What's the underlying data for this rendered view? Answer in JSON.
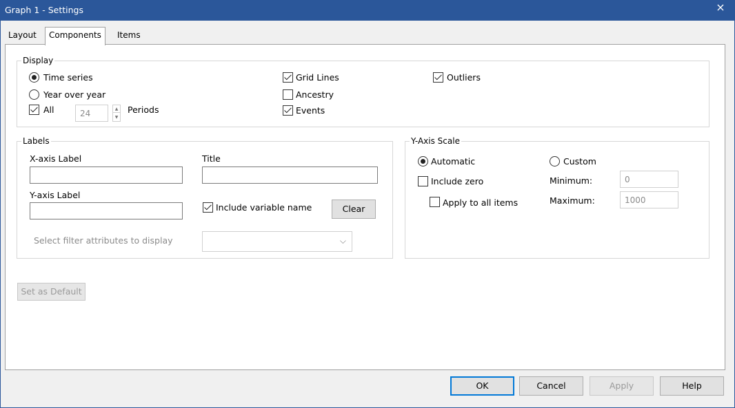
{
  "window": {
    "title": "Graph 1 - Settings",
    "close_glyph": "×"
  },
  "tabs": [
    {
      "label": "Layout",
      "active": false
    },
    {
      "label": "Components",
      "active": true
    },
    {
      "label": "Items",
      "active": false
    }
  ],
  "display": {
    "legend": "Display",
    "time_series": {
      "label": "Time series",
      "checked": true
    },
    "year_over_year": {
      "label": "Year over year",
      "checked": false
    },
    "all": {
      "label": "All",
      "checked": true
    },
    "periods": {
      "value": "24",
      "label": "Periods"
    },
    "grid_lines": {
      "label": "Grid Lines",
      "checked": true
    },
    "ancestry": {
      "label": "Ancestry",
      "checked": false
    },
    "events": {
      "label": "Events",
      "checked": true
    },
    "outliers": {
      "label": "Outliers",
      "checked": true
    }
  },
  "labels": {
    "legend": "Labels",
    "x_axis_label": {
      "label": "X-axis Label",
      "value": ""
    },
    "title": {
      "label": "Title",
      "value": ""
    },
    "y_axis_label": {
      "label": "Y-axis Label",
      "value": ""
    },
    "include_variable_name": {
      "label": "Include variable name",
      "checked": true
    },
    "clear_button": "Clear",
    "filter_attributes": {
      "label": "Select filter attributes to display",
      "value": ""
    }
  },
  "y_axis_scale": {
    "legend": "Y-Axis Scale",
    "automatic": {
      "label": "Automatic",
      "checked": true
    },
    "custom": {
      "label": "Custom",
      "checked": false
    },
    "include_zero": {
      "label": "Include zero",
      "checked": false
    },
    "apply_to_all": {
      "label": "Apply to all items",
      "checked": false
    },
    "minimum": {
      "label": "Minimum:",
      "value": "0"
    },
    "maximum": {
      "label": "Maximum:",
      "value": "1000"
    }
  },
  "set_as_default_button": "Set as Default",
  "footer": {
    "ok": "OK",
    "cancel": "Cancel",
    "apply": "Apply",
    "help": "Help"
  },
  "colors": {
    "titlebar": "#2b579a",
    "primary_border": "#0078d7"
  }
}
